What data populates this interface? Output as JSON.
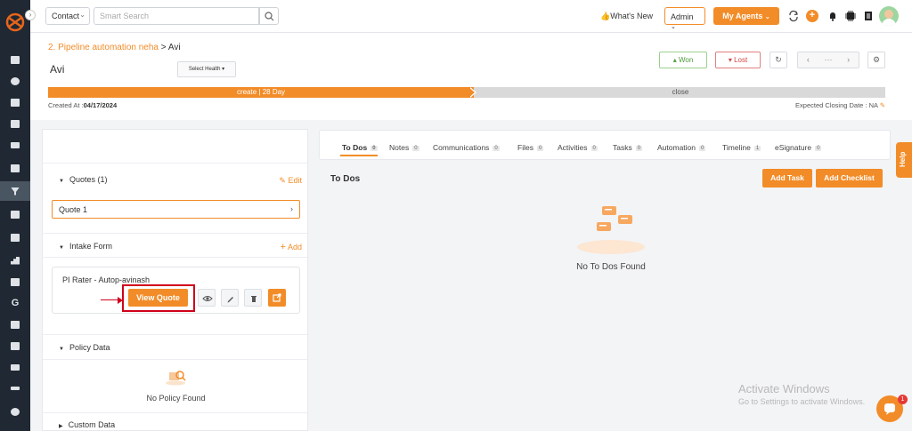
{
  "topbar": {
    "module_select": "Contact",
    "search_placeholder": "Smart Search",
    "whats_new": "What's New",
    "admin_label": "Admin",
    "my_agents_label": "My Agents",
    "plus_icon": "+"
  },
  "header": {
    "breadcrumb_link": "2. Pipeline automation neha",
    "breadcrumb_sep": ">",
    "breadcrumb_current": "Avi",
    "title": "Avi",
    "select_health": "Select Health",
    "won_label": "Won",
    "lost_label": "Lost",
    "pager_more": "···",
    "stage_current": "create | 28 Day",
    "stage_next": "close",
    "created_label": "Created At :",
    "created_value": "04/17/2024",
    "closing_label": "Expected Closing Date : NA"
  },
  "left_panel": {
    "quotes_title": "Quotes (1)",
    "quotes_action": "Edit",
    "quote_item": "Quote 1",
    "intake_title": "Intake Form",
    "intake_action": "Add",
    "intake_item": "PI Rater - Autop-avinash",
    "view_quote_label": "View Quote",
    "policy_title": "Policy Data",
    "no_policy": "No Policy Found",
    "custom_title": "Custom Data"
  },
  "right_panel": {
    "tabs": [
      {
        "label": "To Dos",
        "count": "0"
      },
      {
        "label": "Notes",
        "count": "0"
      },
      {
        "label": "Communications",
        "count": "0"
      },
      {
        "label": "Files",
        "count": "0"
      },
      {
        "label": "Activities",
        "count": "0"
      },
      {
        "label": "Tasks",
        "count": "0"
      },
      {
        "label": "Automation",
        "count": "0"
      },
      {
        "label": "Timeline",
        "count": "1"
      },
      {
        "label": "eSignature",
        "count": "0"
      }
    ],
    "section_title": "To Dos",
    "add_task": "Add Task",
    "add_checklist": "Add Checklist",
    "empty_text": "No To Dos Found"
  },
  "overlay": {
    "help_label": "Help",
    "activate_title": "Activate Windows",
    "activate_sub": "Go to Settings to activate Windows.",
    "chat_badge": "1"
  },
  "colors": {
    "accent": "#f28c28",
    "sidebar": "#1f2833",
    "highlight": "#d0021b"
  }
}
